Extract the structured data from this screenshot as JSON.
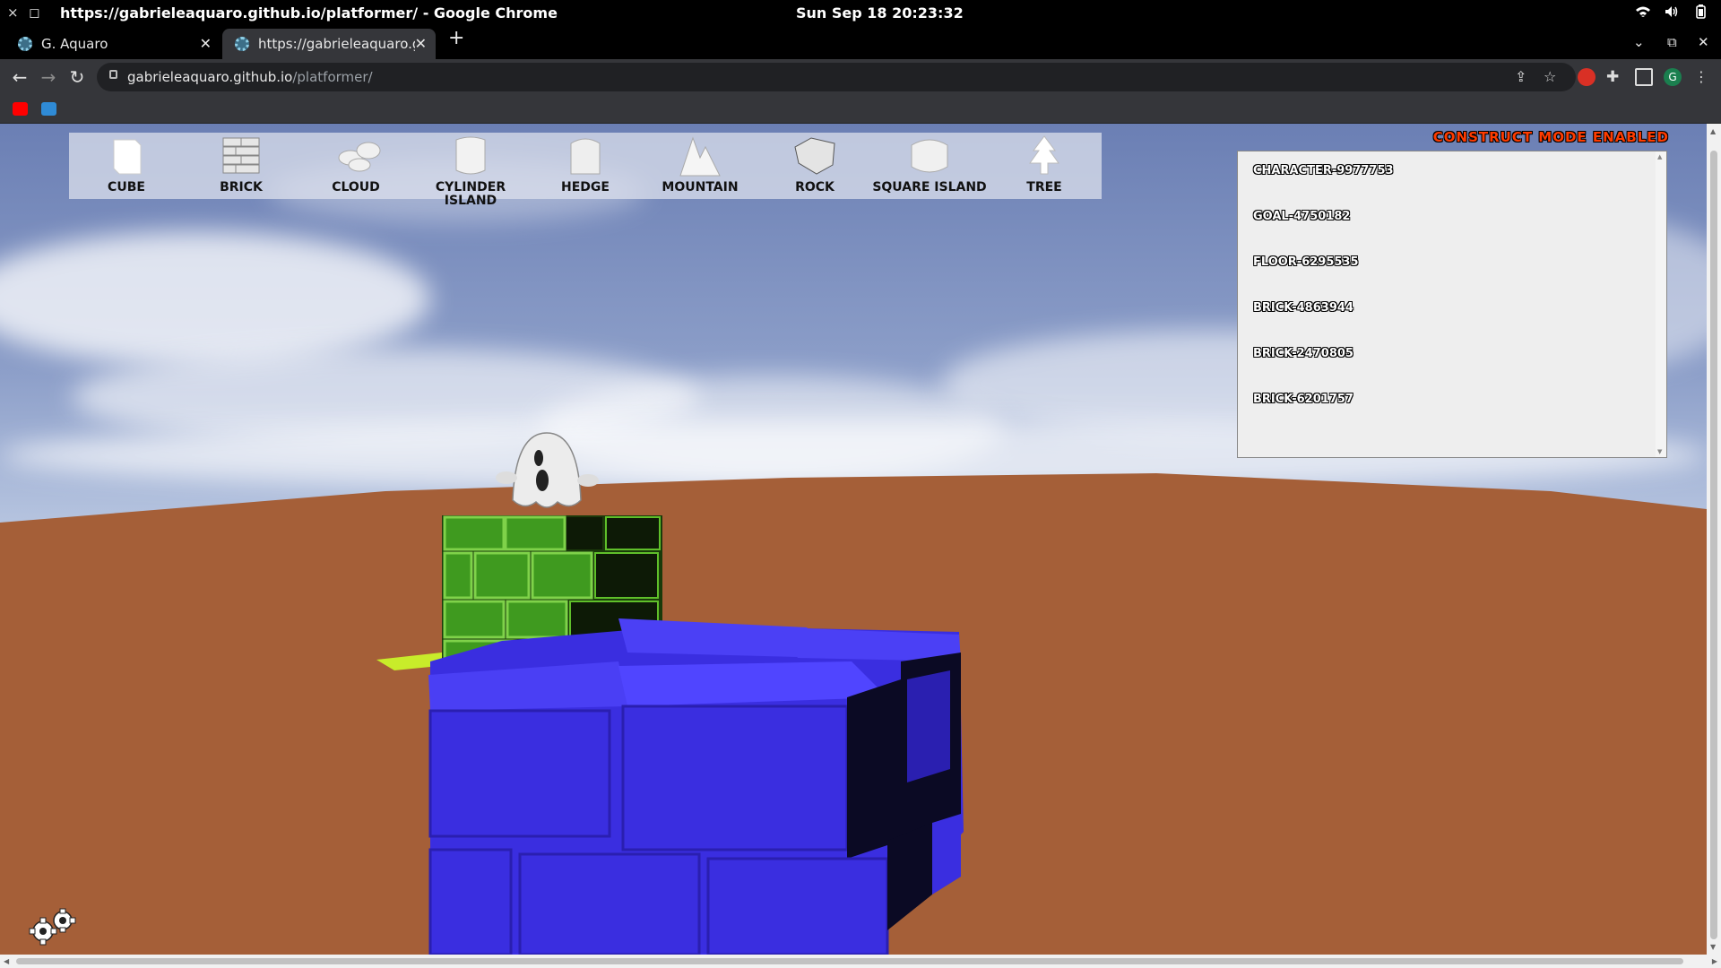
{
  "os": {
    "window_title": "https://gabrieleaquaro.github.io/platformer/ - Google Chrome",
    "clock": "Sun Sep 18  20:23:32",
    "close_glyph": "×",
    "minimize_glyph": "◻"
  },
  "tabs": [
    {
      "label": "G. Aquaro",
      "favicon_color": "#5fa8c8"
    },
    {
      "label": "https://gabrieleaquaro.github.io/platformer/",
      "favicon_color": "#5fa8c8"
    }
  ],
  "toolbar": {
    "url_host": "gabrieleaquaro.github.io",
    "url_path": "/platformer/",
    "profile_initial": "G"
  },
  "game": {
    "palette": [
      {
        "label": "Cube",
        "icon": "cube-icon"
      },
      {
        "label": "Brick",
        "icon": "brick-icon"
      },
      {
        "label": "Cloud",
        "icon": "cloud-icon"
      },
      {
        "label": "Cylinder Island",
        "icon": "cylinder-island-icon"
      },
      {
        "label": "Hedge",
        "icon": "hedge-icon"
      },
      {
        "label": "Mountain",
        "icon": "mountain-icon"
      },
      {
        "label": "Rock",
        "icon": "rock-icon"
      },
      {
        "label": "Square Island",
        "icon": "square-island-icon"
      },
      {
        "label": "Tree",
        "icon": "tree-icon"
      }
    ],
    "mode_label": "Construct mode enabled",
    "objects": [
      "Character-9977753",
      "Goal-4750182",
      "Floor-6295535",
      "Brick-4863944",
      "Brick-2470805",
      "Brick-6201757"
    ],
    "colors": {
      "ground": "#a55f38",
      "green_brick": "#3f9a1f",
      "blue_brick": "#3a2ee0",
      "mode_label": "#ff3b00"
    }
  }
}
